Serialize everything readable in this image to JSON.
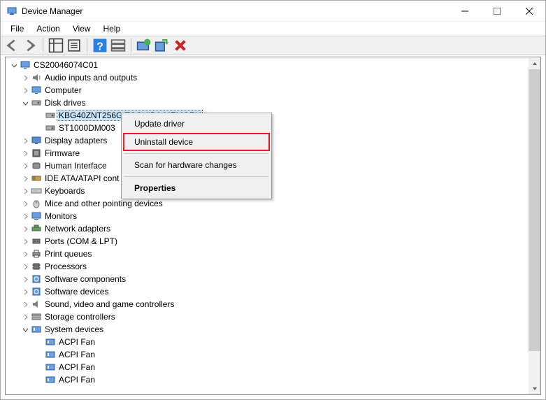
{
  "window": {
    "title": "Device Manager"
  },
  "menubar": [
    "File",
    "Action",
    "View",
    "Help"
  ],
  "tree": {
    "root_label": "CS20046074C01",
    "categories": [
      {
        "icon": "audio",
        "label": "Audio inputs and outputs",
        "expanded": false
      },
      {
        "icon": "computer",
        "label": "Computer",
        "expanded": false
      },
      {
        "icon": "disk",
        "label": "Disk drives",
        "expanded": true,
        "children": [
          {
            "icon": "disk",
            "label": "KBG40ZNT256G TOSHIBA MEMORY",
            "selected": true
          },
          {
            "icon": "disk",
            "label": "ST1000DM003"
          }
        ]
      },
      {
        "icon": "display",
        "label": "Display adapters",
        "expanded": false
      },
      {
        "icon": "firmware",
        "label": "Firmware",
        "expanded": false
      },
      {
        "icon": "hid",
        "label": "Human Interface",
        "expanded": false
      },
      {
        "icon": "ide",
        "label": "IDE ATA/ATAPI cont",
        "expanded": false
      },
      {
        "icon": "keyboard",
        "label": "Keyboards",
        "expanded": false
      },
      {
        "icon": "mouse",
        "label": "Mice and other pointing devices",
        "expanded": false
      },
      {
        "icon": "monitor",
        "label": "Monitors",
        "expanded": false
      },
      {
        "icon": "network",
        "label": "Network adapters",
        "expanded": false
      },
      {
        "icon": "port",
        "label": "Ports (COM & LPT)",
        "expanded": false
      },
      {
        "icon": "printer",
        "label": "Print queues",
        "expanded": false
      },
      {
        "icon": "cpu",
        "label": "Processors",
        "expanded": false
      },
      {
        "icon": "sw",
        "label": "Software components",
        "expanded": false
      },
      {
        "icon": "sw",
        "label": "Software devices",
        "expanded": false
      },
      {
        "icon": "sound",
        "label": "Sound, video and game controllers",
        "expanded": false
      },
      {
        "icon": "storage",
        "label": "Storage controllers",
        "expanded": false
      },
      {
        "icon": "system",
        "label": "System devices",
        "expanded": true,
        "children": [
          {
            "icon": "system",
            "label": "ACPI Fan"
          },
          {
            "icon": "system",
            "label": "ACPI Fan"
          },
          {
            "icon": "system",
            "label": "ACPI Fan"
          },
          {
            "icon": "system",
            "label": "ACPI Fan"
          }
        ]
      }
    ]
  },
  "context_menu": {
    "items": [
      {
        "label": "Update driver"
      },
      {
        "label": "Uninstall device",
        "highlighted": true
      },
      {
        "label": "Scan for hardware changes"
      },
      {
        "label": "Properties",
        "bold": true
      }
    ]
  }
}
